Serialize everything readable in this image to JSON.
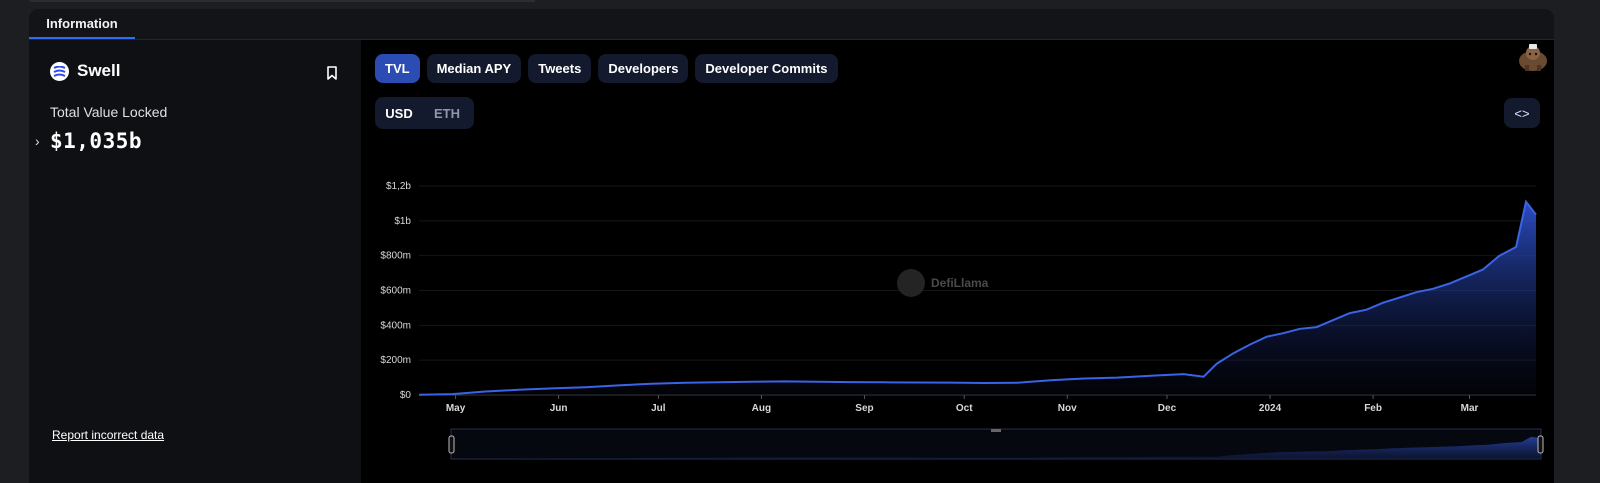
{
  "tabs": {
    "information": "Information"
  },
  "protocol": {
    "name": "Swell",
    "tvl_label": "Total Value Locked",
    "tvl_value": "$1,035b",
    "report_link": "Report incorrect data"
  },
  "chart_tabs": [
    "TVL",
    "Median APY",
    "Tweets",
    "Developers",
    "Developer Commits"
  ],
  "currency_toggle": {
    "options": [
      "USD",
      "ETH"
    ],
    "selected": "USD"
  },
  "watermark": "DefiLlama",
  "colors": {
    "accent": "#2b4db3",
    "line": "#3a63e6",
    "background": "#000000"
  },
  "icons": {
    "logo": "swell-logo-icon",
    "bookmark": "bookmark-icon",
    "embed": "embed-code-icon",
    "expand": "chevron-right-icon"
  },
  "chart_data": {
    "type": "area",
    "ylabel": "",
    "xlabel": "",
    "y_ticks": [
      0,
      200,
      400,
      600,
      800,
      1000,
      1200
    ],
    "y_tick_labels": [
      "$0",
      "$200m",
      "$400m",
      "$600m",
      "$800m",
      "$1b",
      "$1,2b"
    ],
    "ylim": [
      0,
      1200
    ],
    "x_ticks": [
      "May",
      "Jun",
      "Jul",
      "Aug",
      "Sep",
      "Oct",
      "Nov",
      "Dec",
      "2024",
      "Feb",
      "Mar"
    ],
    "x_tick_index": [
      11,
      42,
      72,
      103,
      134,
      164,
      195,
      225,
      256,
      287,
      316
    ],
    "x_range": [
      0,
      336
    ],
    "series": [
      {
        "x": [
          0,
          10,
          20,
          30,
          40,
          50,
          60,
          70,
          80,
          90,
          100,
          110,
          120,
          130,
          140,
          150,
          160,
          170,
          180,
          190,
          200,
          210,
          220,
          230,
          236,
          240,
          245,
          250,
          255,
          260,
          265,
          270,
          275,
          280,
          285,
          290,
          295,
          300,
          305,
          310,
          315,
          320,
          325,
          330,
          333,
          336
        ],
        "values": [
          2,
          5,
          20,
          30,
          38,
          45,
          55,
          65,
          70,
          73,
          76,
          78,
          76,
          74,
          73,
          72,
          71,
          69,
          70,
          85,
          95,
          100,
          110,
          120,
          105,
          180,
          240,
          290,
          335,
          355,
          380,
          390,
          430,
          470,
          490,
          530,
          560,
          590,
          610,
          640,
          680,
          720,
          800,
          850,
          1110,
          1035
        ]
      }
    ]
  }
}
